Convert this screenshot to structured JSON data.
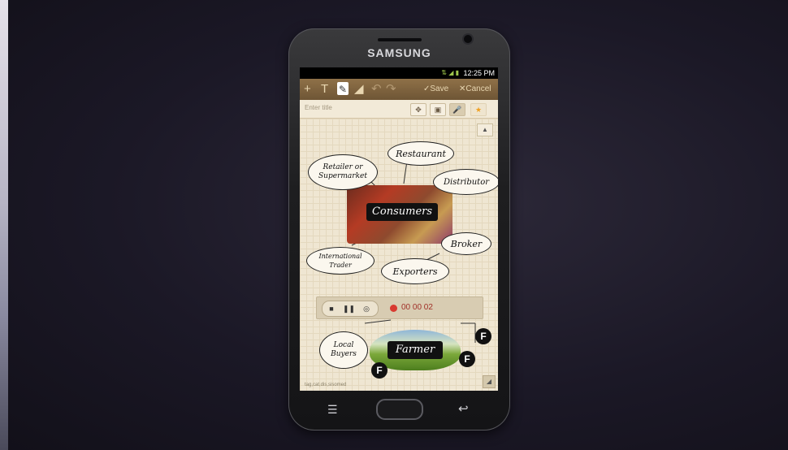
{
  "device": {
    "brand": "SAMSUNG"
  },
  "status_bar": {
    "icons": "⇅ ◢ ▮",
    "time": "12:25 PM"
  },
  "toolbar": {
    "add_icon": "+",
    "text_icon": "T",
    "pen_icon": "✎",
    "eraser_icon": "◢",
    "undo_icon": "↶",
    "redo_icon": "↷",
    "save_label": "✓Save",
    "cancel_label": "✕Cancel"
  },
  "note": {
    "title_placeholder": "Enter title",
    "tools": [
      "✥",
      "▣",
      "🎤",
      "★"
    ],
    "footnote": "tag,cat,dis,sisomed"
  },
  "diagram": {
    "retailer": "Retailer or Supermarket",
    "restaurant": "Restaurant",
    "distributor": "Distributor",
    "consumers": "Consumers",
    "international_trader": "International Trader",
    "broker": "Broker",
    "exporters": "Exporters",
    "local_buyers": "Local Buyers",
    "farmer": "Farmer",
    "fb_letter": "F"
  },
  "recorder": {
    "stop_icon": "■",
    "pause_icon": "❚❚",
    "record_icon": "◎",
    "elapsed": "00 00 02"
  },
  "nav": {
    "menu_icon": "☰",
    "back_icon": "↩"
  },
  "colors": {
    "toolbar": "#7a5f3c",
    "paper": "#efe5cf",
    "recording": "#d83a30"
  }
}
